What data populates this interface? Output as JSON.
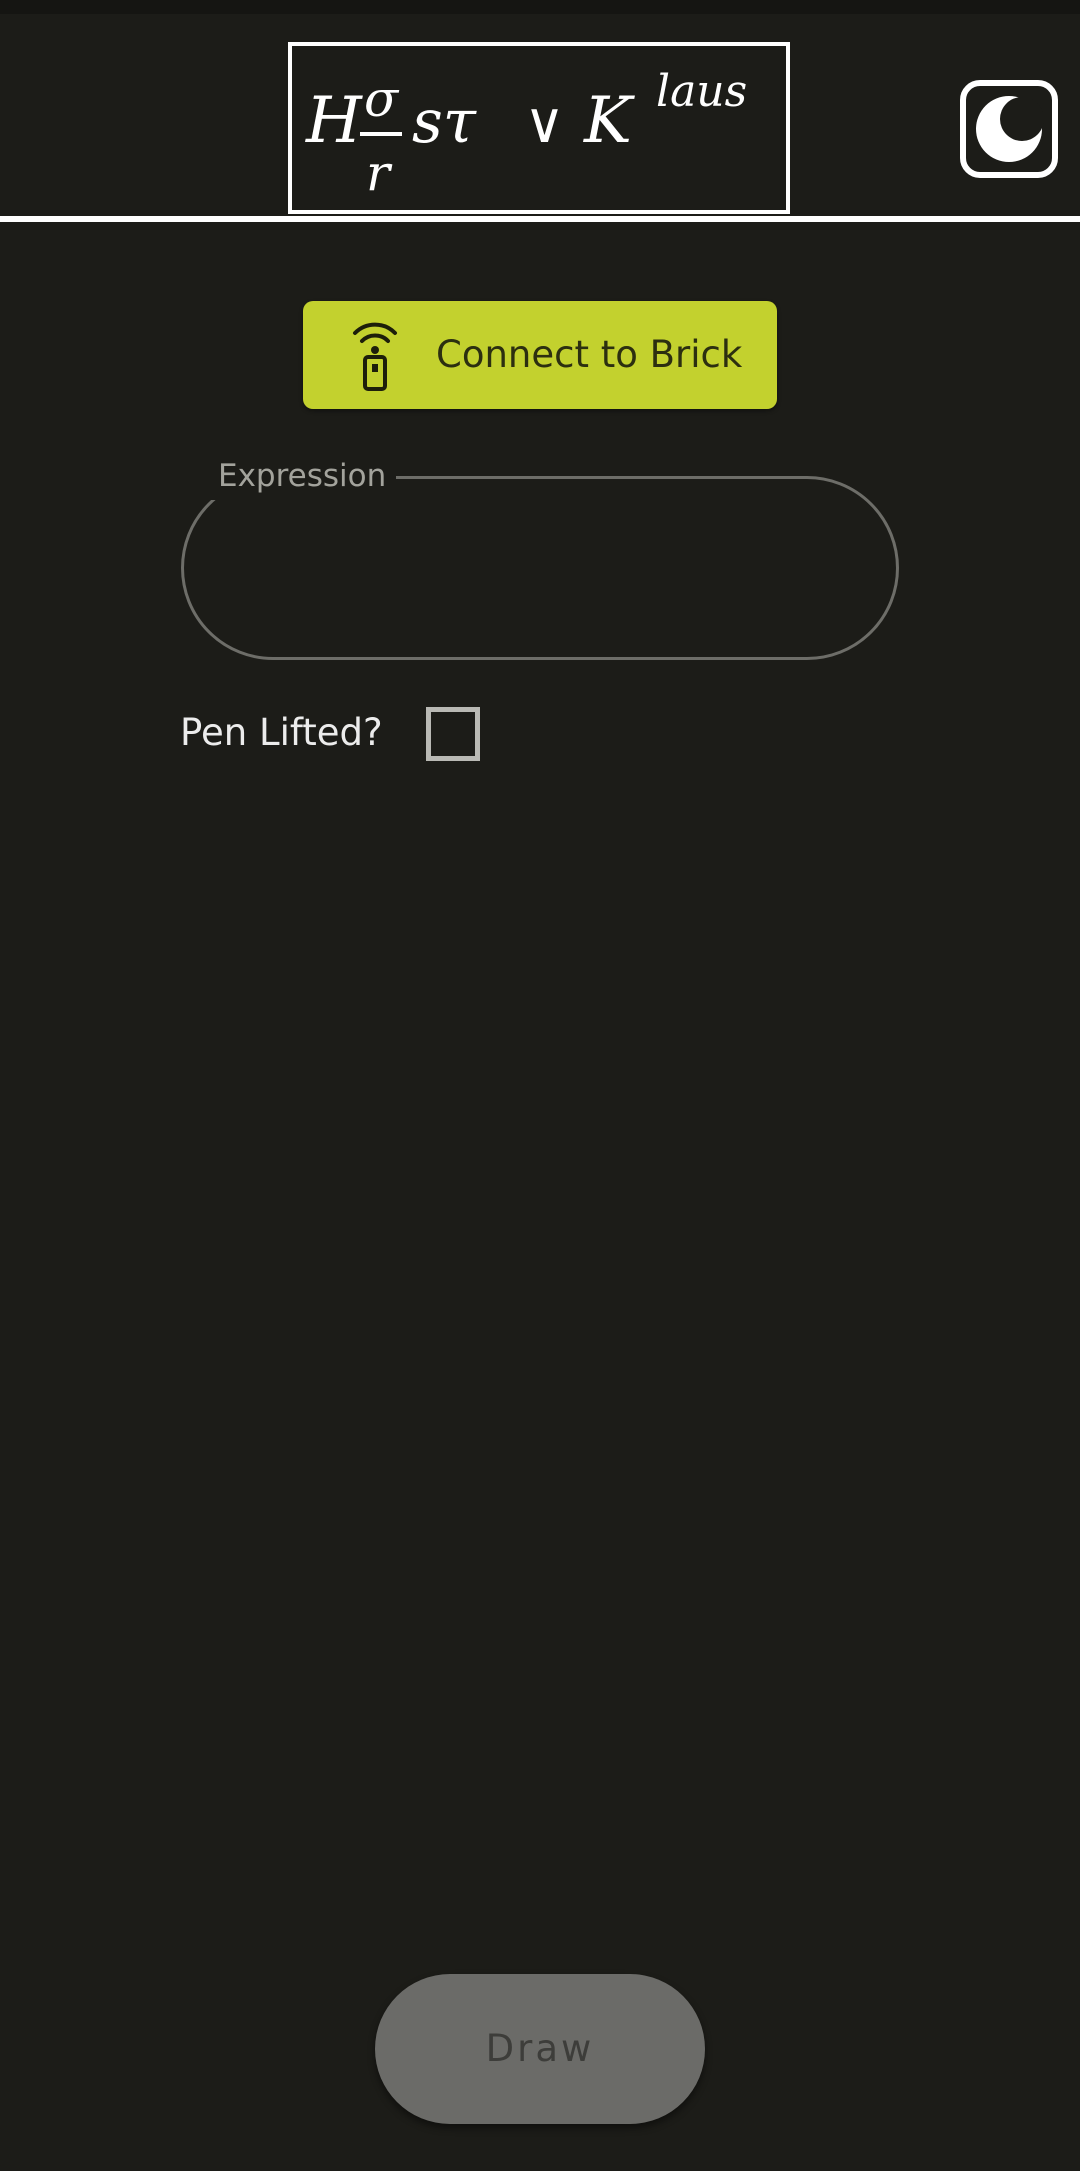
{
  "header": {
    "logo_alt_text": "Hσ/r sτ ∨ K^laus",
    "theme_toggle_icon": "moon-icon"
  },
  "connect": {
    "label": "Connect to Brick",
    "icon": "remote-signal-icon",
    "color": "#c3d12e"
  },
  "expression": {
    "label": "Expression",
    "value": ""
  },
  "pen": {
    "label": "Pen Lifted?",
    "checked": false
  },
  "draw": {
    "label": "Draw"
  },
  "colors": {
    "background": "#1c1c18",
    "accent": "#c3d12e",
    "disabled_button": "#6b6b68"
  }
}
